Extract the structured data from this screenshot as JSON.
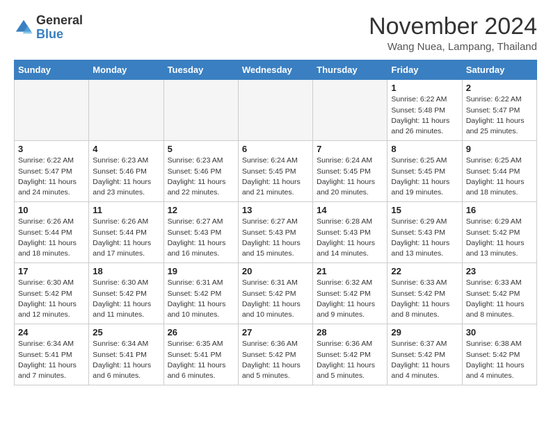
{
  "logo": {
    "general": "General",
    "blue": "Blue"
  },
  "header": {
    "month": "November 2024",
    "location": "Wang Nuea, Lampang, Thailand"
  },
  "weekdays": [
    "Sunday",
    "Monday",
    "Tuesday",
    "Wednesday",
    "Thursday",
    "Friday",
    "Saturday"
  ],
  "weeks": [
    [
      {
        "day": "",
        "info": ""
      },
      {
        "day": "",
        "info": ""
      },
      {
        "day": "",
        "info": ""
      },
      {
        "day": "",
        "info": ""
      },
      {
        "day": "",
        "info": ""
      },
      {
        "day": "1",
        "info": "Sunrise: 6:22 AM\nSunset: 5:48 PM\nDaylight: 11 hours\nand 26 minutes."
      },
      {
        "day": "2",
        "info": "Sunrise: 6:22 AM\nSunset: 5:47 PM\nDaylight: 11 hours\nand 25 minutes."
      }
    ],
    [
      {
        "day": "3",
        "info": "Sunrise: 6:22 AM\nSunset: 5:47 PM\nDaylight: 11 hours\nand 24 minutes."
      },
      {
        "day": "4",
        "info": "Sunrise: 6:23 AM\nSunset: 5:46 PM\nDaylight: 11 hours\nand 23 minutes."
      },
      {
        "day": "5",
        "info": "Sunrise: 6:23 AM\nSunset: 5:46 PM\nDaylight: 11 hours\nand 22 minutes."
      },
      {
        "day": "6",
        "info": "Sunrise: 6:24 AM\nSunset: 5:45 PM\nDaylight: 11 hours\nand 21 minutes."
      },
      {
        "day": "7",
        "info": "Sunrise: 6:24 AM\nSunset: 5:45 PM\nDaylight: 11 hours\nand 20 minutes."
      },
      {
        "day": "8",
        "info": "Sunrise: 6:25 AM\nSunset: 5:45 PM\nDaylight: 11 hours\nand 19 minutes."
      },
      {
        "day": "9",
        "info": "Sunrise: 6:25 AM\nSunset: 5:44 PM\nDaylight: 11 hours\nand 18 minutes."
      }
    ],
    [
      {
        "day": "10",
        "info": "Sunrise: 6:26 AM\nSunset: 5:44 PM\nDaylight: 11 hours\nand 18 minutes."
      },
      {
        "day": "11",
        "info": "Sunrise: 6:26 AM\nSunset: 5:44 PM\nDaylight: 11 hours\nand 17 minutes."
      },
      {
        "day": "12",
        "info": "Sunrise: 6:27 AM\nSunset: 5:43 PM\nDaylight: 11 hours\nand 16 minutes."
      },
      {
        "day": "13",
        "info": "Sunrise: 6:27 AM\nSunset: 5:43 PM\nDaylight: 11 hours\nand 15 minutes."
      },
      {
        "day": "14",
        "info": "Sunrise: 6:28 AM\nSunset: 5:43 PM\nDaylight: 11 hours\nand 14 minutes."
      },
      {
        "day": "15",
        "info": "Sunrise: 6:29 AM\nSunset: 5:43 PM\nDaylight: 11 hours\nand 13 minutes."
      },
      {
        "day": "16",
        "info": "Sunrise: 6:29 AM\nSunset: 5:42 PM\nDaylight: 11 hours\nand 13 minutes."
      }
    ],
    [
      {
        "day": "17",
        "info": "Sunrise: 6:30 AM\nSunset: 5:42 PM\nDaylight: 11 hours\nand 12 minutes."
      },
      {
        "day": "18",
        "info": "Sunrise: 6:30 AM\nSunset: 5:42 PM\nDaylight: 11 hours\nand 11 minutes."
      },
      {
        "day": "19",
        "info": "Sunrise: 6:31 AM\nSunset: 5:42 PM\nDaylight: 11 hours\nand 10 minutes."
      },
      {
        "day": "20",
        "info": "Sunrise: 6:31 AM\nSunset: 5:42 PM\nDaylight: 11 hours\nand 10 minutes."
      },
      {
        "day": "21",
        "info": "Sunrise: 6:32 AM\nSunset: 5:42 PM\nDaylight: 11 hours\nand 9 minutes."
      },
      {
        "day": "22",
        "info": "Sunrise: 6:33 AM\nSunset: 5:42 PM\nDaylight: 11 hours\nand 8 minutes."
      },
      {
        "day": "23",
        "info": "Sunrise: 6:33 AM\nSunset: 5:42 PM\nDaylight: 11 hours\nand 8 minutes."
      }
    ],
    [
      {
        "day": "24",
        "info": "Sunrise: 6:34 AM\nSunset: 5:41 PM\nDaylight: 11 hours\nand 7 minutes."
      },
      {
        "day": "25",
        "info": "Sunrise: 6:34 AM\nSunset: 5:41 PM\nDaylight: 11 hours\nand 6 minutes."
      },
      {
        "day": "26",
        "info": "Sunrise: 6:35 AM\nSunset: 5:41 PM\nDaylight: 11 hours\nand 6 minutes."
      },
      {
        "day": "27",
        "info": "Sunrise: 6:36 AM\nSunset: 5:42 PM\nDaylight: 11 hours\nand 5 minutes."
      },
      {
        "day": "28",
        "info": "Sunrise: 6:36 AM\nSunset: 5:42 PM\nDaylight: 11 hours\nand 5 minutes."
      },
      {
        "day": "29",
        "info": "Sunrise: 6:37 AM\nSunset: 5:42 PM\nDaylight: 11 hours\nand 4 minutes."
      },
      {
        "day": "30",
        "info": "Sunrise: 6:38 AM\nSunset: 5:42 PM\nDaylight: 11 hours\nand 4 minutes."
      }
    ]
  ]
}
